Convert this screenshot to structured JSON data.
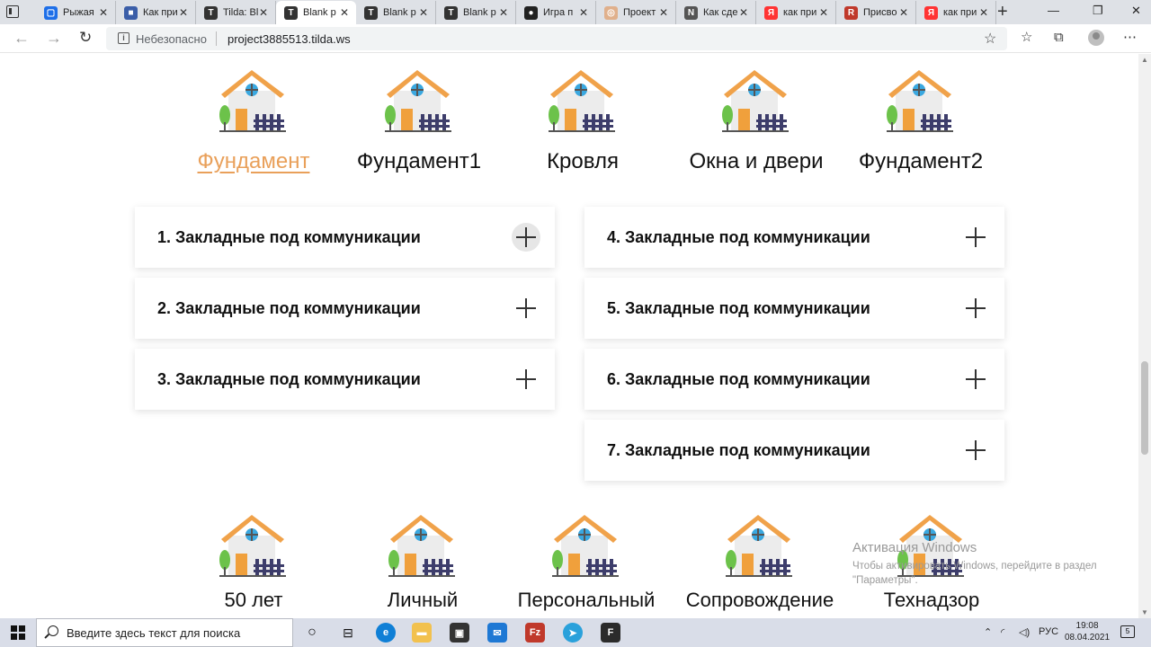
{
  "browser": {
    "tabs": [
      {
        "title": "Рыжая",
        "fav_color": "#1e6fe8",
        "fav_glyph": "▢",
        "active": false
      },
      {
        "title": "Как при",
        "fav_color": "#3b5ea8",
        "fav_glyph": "■",
        "active": false
      },
      {
        "title": "Tilda: Bl",
        "fav_color": "#333333",
        "fav_glyph": "T",
        "active": false
      },
      {
        "title": "Blank p",
        "fav_color": "#333333",
        "fav_glyph": "T",
        "active": true
      },
      {
        "title": "Blank p",
        "fav_color": "#333333",
        "fav_glyph": "T",
        "active": false
      },
      {
        "title": "Blank p",
        "fav_color": "#333333",
        "fav_glyph": "T",
        "active": false
      },
      {
        "title": "Игра п",
        "fav_color": "#222222",
        "fav_glyph": "●",
        "active": false
      },
      {
        "title": "Проект",
        "fav_color": "#e0b08c",
        "fav_glyph": "◎",
        "active": false
      },
      {
        "title": "Как сде",
        "fav_color": "#555555",
        "fav_glyph": "N",
        "active": false
      },
      {
        "title": "как при",
        "fav_color": "#ff3333",
        "fav_glyph": "Я",
        "active": false
      },
      {
        "title": "Присво",
        "fav_color": "#c0392b",
        "fav_glyph": "R",
        "active": false
      },
      {
        "title": "как при",
        "fav_color": "#ff3333",
        "fav_glyph": "Я",
        "active": false
      }
    ],
    "insecure_label": "Небезопасно",
    "url": "project3885513.tilda.ws"
  },
  "top_icons": [
    {
      "label": "Фундамент",
      "active": true
    },
    {
      "label": "Фундамент1",
      "active": false
    },
    {
      "label": "Кровля",
      "active": false
    },
    {
      "label": "Окна и двери",
      "active": false
    },
    {
      "label": "Фундамент2",
      "active": false
    }
  ],
  "accordion_left": [
    {
      "title": "1. Закладные под коммуникации"
    },
    {
      "title": "2. Закладные под коммуникации"
    },
    {
      "title": "3. Закладные под коммуникации"
    }
  ],
  "accordion_right": [
    {
      "title": "4. Закладные под коммуникации"
    },
    {
      "title": "5. Закладные под коммуникации"
    },
    {
      "title": "6. Закладные под коммуникации"
    },
    {
      "title": "7. Закладные под коммуникации"
    }
  ],
  "bottom_icons": [
    {
      "label": "50 лет"
    },
    {
      "label": "Личный"
    },
    {
      "label": "Персональный"
    },
    {
      "label": "Сопровождение"
    },
    {
      "label": "Технадзор"
    }
  ],
  "watermark": {
    "title": "Активация Windows",
    "subtitle": "Чтобы активировать Windows, перейдите в раздел \"Параметры\"."
  },
  "taskbar": {
    "search_placeholder": "Введите здесь текст для поиска",
    "language": "РУС",
    "time": "19:08",
    "date": "08.04.2021",
    "notification_count": "5"
  },
  "colors": {
    "accent": "#e9a05a",
    "house_wall": "#ececec",
    "house_roof": "#f0a24a",
    "house_door": "#f0a03c",
    "house_window": "#3aa8e0",
    "fence": "#3d3d6b",
    "tree": "#6cc24a"
  }
}
